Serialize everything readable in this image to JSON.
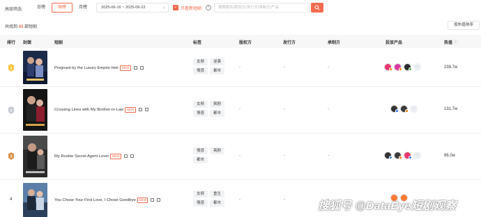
{
  "filters": {
    "label": "高级筛选:",
    "tabs": [
      {
        "label": "日榜"
      },
      {
        "label": "周榜",
        "active": true
      },
      {
        "label": "月榜"
      }
    ],
    "date_range": "2025-06-16 ~ 2025-06-22",
    "only_new_label": "只看新短剧",
    "only_new_checked": true,
    "search_placeholder": "搜索剧名/版权方/发行方/承制方/产品"
  },
  "summary": {
    "prefix": "共找到",
    "count": "43",
    "suffix": "部短剧"
  },
  "sort_label": "按热值排序",
  "columns": {
    "rank": "排行",
    "cover": "封面",
    "drama": "短剧",
    "tags": "标签",
    "copyright": "版权方",
    "publisher": "发行方",
    "producer": "承制方",
    "products": "投放产品",
    "heat": "热值"
  },
  "rows": [
    {
      "rank": "1",
      "rank_icon": "gold-medal-icon",
      "title": "Pregnant by the Luxury Empire Heir",
      "new": "NEW",
      "tags": [
        "女频",
        "逆袭",
        "情感",
        "都市"
      ],
      "copyright": "-",
      "publisher": "-",
      "producer": "-",
      "apps": [
        "pink",
        "pink",
        "dark"
      ],
      "heat": "239.7w"
    },
    {
      "rank": "2",
      "rank_icon": "silver-medal-icon",
      "title": "Crossing Lines with My Brother-in-Law",
      "new": "NEW",
      "tags": [
        "女频",
        "爽剧",
        "情感",
        "都市"
      ],
      "copyright": "-",
      "publisher": "-",
      "producer": "-",
      "apps": [
        "dark",
        "dark"
      ],
      "heat": "131.7w"
    },
    {
      "rank": "3",
      "rank_icon": "bronze-medal-icon",
      "title": "My Rookie Secret Agent Lover",
      "new": "NEW",
      "tags": [
        "情感",
        "爽剧",
        "都市"
      ],
      "copyright": "-",
      "publisher": "-",
      "producer": "-",
      "apps": [
        "dark",
        "dark",
        "pink"
      ],
      "heat": "86.0w"
    },
    {
      "rank": "4",
      "rank_icon": "",
      "title": "You Chose Your First Love, I Chose Goodbye",
      "new": "NEW",
      "tags": [
        "女频",
        "重生",
        "情感",
        "都市"
      ],
      "copyright": "-",
      "publisher": "-",
      "producer": "-",
      "apps": [
        "orange",
        "orange"
      ],
      "heat": ""
    }
  ],
  "watermark": "搜狐号 @DataEye短剧观察",
  "colors": {
    "accent": "#f26b4f",
    "header_bg": "#f7f7f8",
    "tag_bg": "#f2f3f5"
  }
}
